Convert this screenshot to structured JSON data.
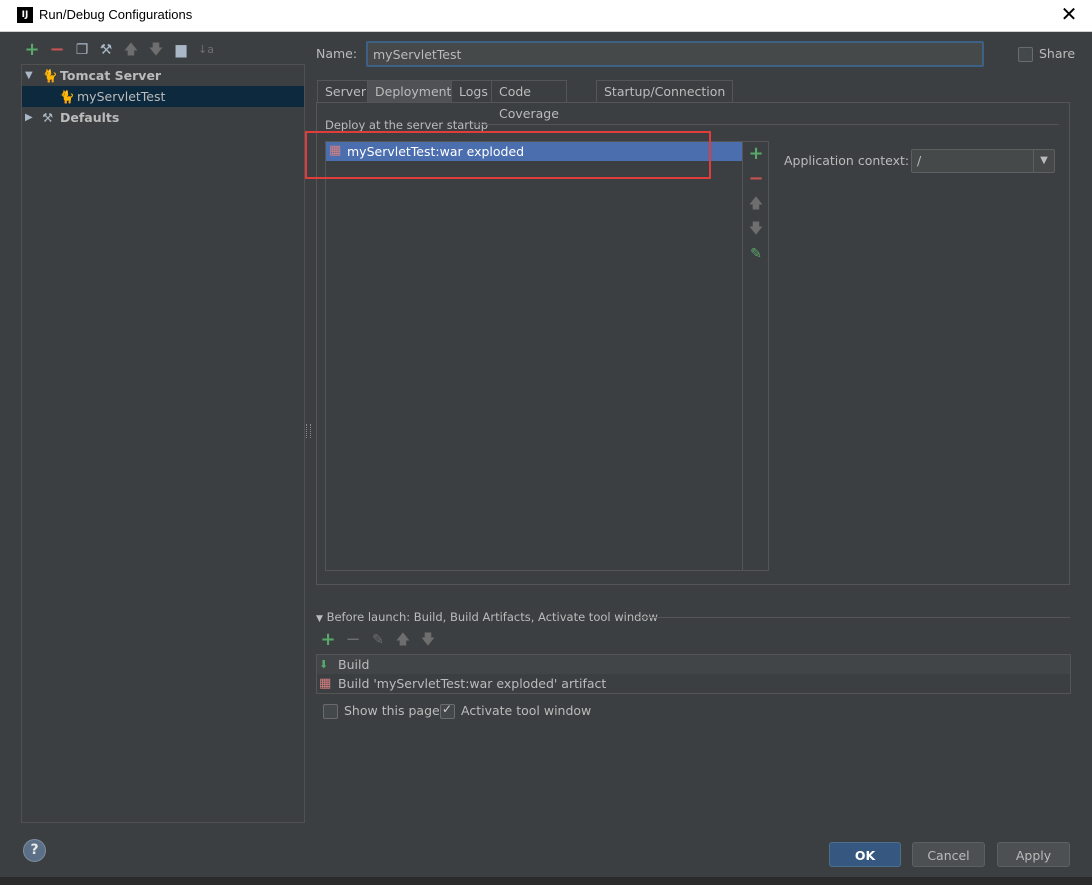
{
  "window": {
    "title": "Run/Debug Configurations",
    "app_icon_text": "IJ"
  },
  "toolbar": {
    "icons": [
      "add-icon",
      "remove-icon",
      "copy-icon",
      "wrench-icon",
      "move-up-icon",
      "move-down-icon",
      "folder-icon",
      "sort-icon"
    ]
  },
  "tree": {
    "items": [
      {
        "label": "Tomcat Server",
        "expanded": true,
        "icon": "tomcat-icon"
      },
      {
        "label": "myServletTest",
        "selected": true,
        "icon": "tomcat-icon"
      },
      {
        "label": "Defaults",
        "expanded": false,
        "icon": "wrench-icon"
      }
    ]
  },
  "config": {
    "name_label": "Name:",
    "name_value": "myServletTest",
    "share_label": "Share",
    "share_checked": false
  },
  "tabs": [
    {
      "label": "Server"
    },
    {
      "label": "Deployment",
      "active": true
    },
    {
      "label": "Logs"
    },
    {
      "label": "Code Coverage"
    },
    {
      "label": "Startup/Connection"
    }
  ],
  "deployment": {
    "section_label": "Deploy at the server startup",
    "items": [
      "myServletTest:war exploded"
    ],
    "side_icons": [
      "add-icon",
      "remove-icon",
      "move-up-icon",
      "move-down-icon",
      "edit-icon"
    ],
    "app_context_label": "Application context:",
    "app_context_value": "/"
  },
  "before_launch": {
    "header": "Before launch: Build, Build Artifacts, Activate tool window",
    "items": [
      "Build",
      "Build 'myServletTest:war exploded' artifact"
    ],
    "show_page_label": "Show this page",
    "show_page_checked": false,
    "activate_label": "Activate tool window",
    "activate_checked": true
  },
  "buttons": {
    "ok": "OK",
    "cancel": "Cancel",
    "apply": "Apply",
    "help": "?"
  },
  "colors": {
    "background": "#3c3f41",
    "selection": "#4b6eaf",
    "highlight_box": "#e03c3c",
    "accent_add": "#59a869",
    "accent_remove": "#c75450"
  }
}
